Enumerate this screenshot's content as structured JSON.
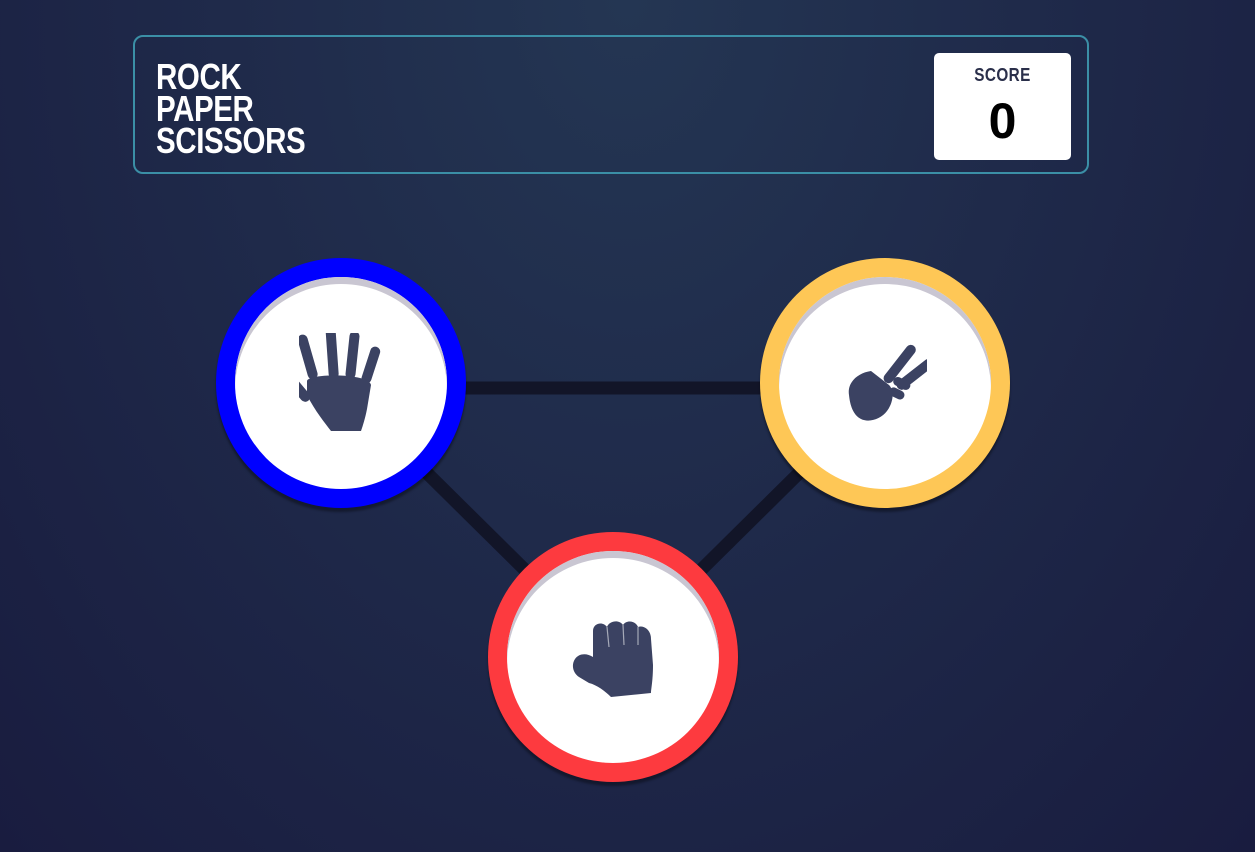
{
  "header": {
    "title_lines": [
      "ROCK",
      "PAPER",
      "SCISSORS"
    ],
    "score_label": "SCORE",
    "score_value": "0"
  },
  "choices": [
    {
      "id": "paper",
      "icon": "hand-paper-icon",
      "ring_color": "#0000ff"
    },
    {
      "id": "scissors",
      "icon": "hand-scissors-icon",
      "ring_color": "#fec756"
    },
    {
      "id": "rock",
      "icon": "hand-rock-icon",
      "ring_color": "#fd3a3f"
    }
  ],
  "colors": {
    "background": "#1f2a4a",
    "header_border": "#3b8fa6",
    "icon": "#3b4262",
    "connector": "#121528"
  }
}
